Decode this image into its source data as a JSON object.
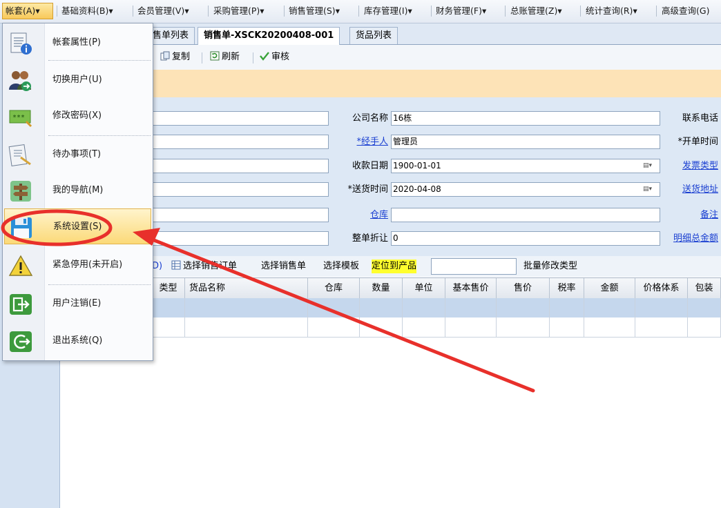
{
  "menubar": {
    "items": [
      {
        "label": "帐套(A)",
        "arrow": "▾"
      },
      {
        "label": "基础资料(B)",
        "arrow": "▾"
      },
      {
        "label": "会员管理(V)",
        "arrow": "▾"
      },
      {
        "label": "采购管理(P)",
        "arrow": "▾"
      },
      {
        "label": "销售管理(S)",
        "arrow": "▾"
      },
      {
        "label": "库存管理(I)",
        "arrow": "▾"
      },
      {
        "label": "财务管理(F)",
        "arrow": "▾"
      },
      {
        "label": "总账管理(Z)",
        "arrow": "▾"
      },
      {
        "label": "统计查询(R)",
        "arrow": "▾"
      },
      {
        "label": "高级查询(G)",
        "arrow": ""
      }
    ]
  },
  "tabs": [
    {
      "label": "售单列表"
    },
    {
      "label": "销售单-XSCK20200408-001"
    },
    {
      "label": "货品列表"
    }
  ],
  "toolbar": {
    "copy": "复制",
    "refresh": "刷新",
    "approve": "审核"
  },
  "form": {
    "company_label": "公司名称",
    "company_value": "16栋",
    "handler_label": "*经手人",
    "handler_value": "管理员",
    "pay_date_label": "收款日期",
    "pay_date_value": "1900-01-01",
    "delivery_label": "*送货时间",
    "delivery_value": "2020-04-08",
    "warehouse_label": "仓库",
    "warehouse_value": "",
    "discount_label": "整单折让",
    "discount_value": "0",
    "phone_label": "联系电话",
    "open_time_label": "*开单时间",
    "invoice_label": "发票类型",
    "address_label": "送货地址",
    "remark_label": "备注",
    "total_label": "明细总金额"
  },
  "gridbar": {
    "partial_d": "D)",
    "select_order": "选择销售订单",
    "select_sales": "选择销售单",
    "select_template": "选择模板",
    "locate_product": "定位到产品",
    "batch_modify": "批量修改类型"
  },
  "grid": {
    "columns": [
      "类型",
      "货品名称",
      "仓库",
      "数量",
      "单位",
      "基本售价",
      "售价",
      "税率",
      "金额",
      "价格体系",
      "包装"
    ]
  },
  "dropdown": {
    "items": [
      {
        "label": "帐套属性(P)",
        "icon": "document-info-icon"
      },
      {
        "label": "切换用户(U)",
        "icon": "switch-user-icon"
      },
      {
        "label": "修改密码(X)",
        "icon": "password-icon"
      },
      {
        "label": "待办事项(T)",
        "icon": "todo-icon"
      },
      {
        "label": "我的导航(M)",
        "icon": "signpost-icon"
      },
      {
        "label": "系统设置(S)",
        "icon": "floppy-disk-icon"
      },
      {
        "label": "紧急停用(未开启)",
        "icon": "warning-icon"
      },
      {
        "label": "用户注销(E)",
        "icon": "logout-icon"
      },
      {
        "label": "退出系统(Q)",
        "icon": "exit-icon"
      }
    ],
    "password_icon_text": "***"
  },
  "colors": {
    "annotation_red": "#e8302b",
    "highlight_yellow": "#ffff2e",
    "link_blue": "#1a3fd1"
  }
}
